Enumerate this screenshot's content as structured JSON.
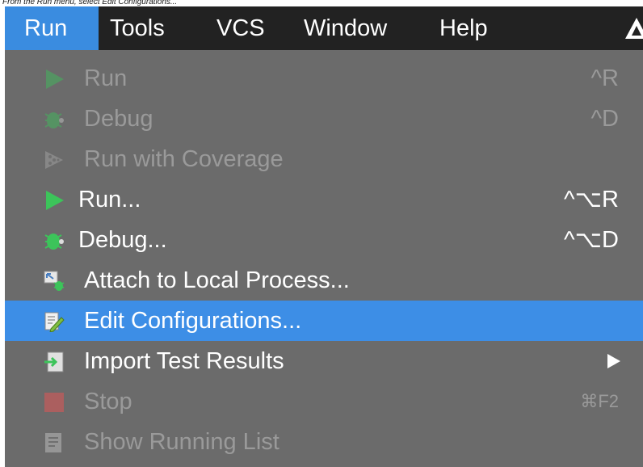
{
  "caption": "From the Run menu, select Edit Configurations...",
  "menubar": {
    "items": [
      {
        "label": "Run"
      },
      {
        "label": "Tools"
      },
      {
        "label": "VCS"
      },
      {
        "label": "Window"
      },
      {
        "label": "Help"
      }
    ],
    "active": "Run"
  },
  "menu": {
    "items": [
      {
        "label": "Run",
        "shortcut": "^R",
        "icon": "run-icon",
        "enabled": false
      },
      {
        "label": "Debug",
        "shortcut": "^D",
        "icon": "debug-icon",
        "enabled": false
      },
      {
        "label": "Run with Coverage",
        "shortcut": "",
        "icon": "coverage-icon",
        "enabled": false
      },
      {
        "label": "Run...",
        "shortcut": "^⌥R",
        "icon": "run-icon",
        "enabled": true
      },
      {
        "label": "Debug...",
        "shortcut": "^⌥D",
        "icon": "debug-icon",
        "enabled": true
      },
      {
        "label": "Attach to Local Process...",
        "shortcut": "",
        "icon": "attach-process-icon",
        "enabled": true
      },
      {
        "label": "Edit Configurations...",
        "shortcut": "",
        "icon": "edit-configurations-icon",
        "enabled": true,
        "selected": true
      },
      {
        "label": "Import Test Results",
        "shortcut": "",
        "icon": "import-icon",
        "enabled": true,
        "submenu": true
      },
      {
        "label": "Stop",
        "shortcut": "⌘F2",
        "icon": "stop-icon",
        "enabled": false
      },
      {
        "label": "Show Running List",
        "shortcut": "",
        "icon": "list-icon",
        "enabled": false
      }
    ]
  },
  "colors": {
    "menubar_bg": "#222222",
    "menu_bg": "#6b6b6b",
    "selection": "#3d8ee6",
    "disabled_text": "#9a9a9a"
  }
}
